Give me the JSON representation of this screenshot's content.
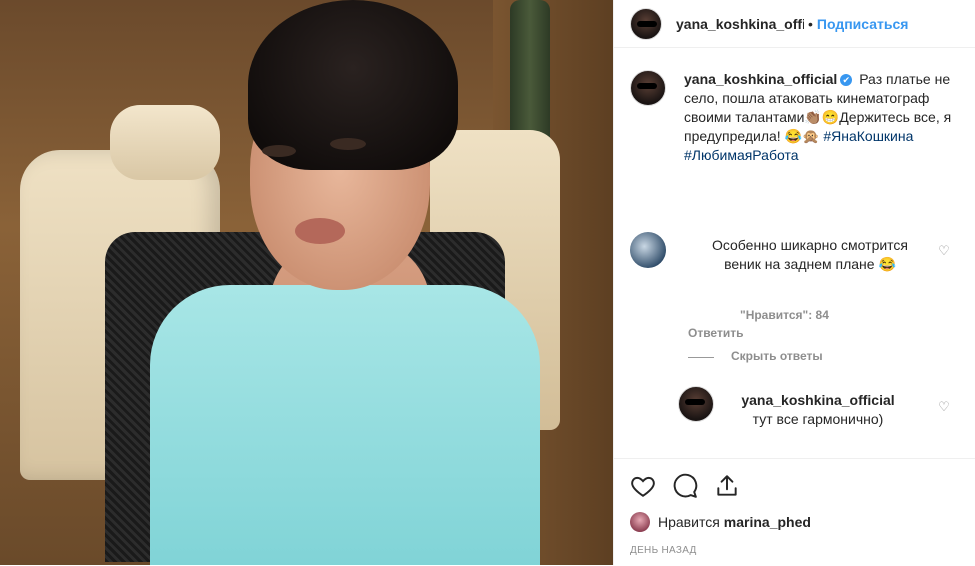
{
  "header": {
    "username": "yana_koshkina_official",
    "separator": "•",
    "follow_label": "Подписаться"
  },
  "caption": {
    "username": "yana_koshkina_official",
    "verified_glyph": "✔",
    "text": "Раз платье не село, пошла атаковать кинематограф своими талантами👏🏽😁Держитесь все, я предупредила! 😂🙊",
    "hashtags": [
      "#ЯнаКошкина",
      "#ЛюбимаяРабота"
    ]
  },
  "comments": [
    {
      "text": "Особенно шикарно смотрится веник на заднем плане 😂",
      "likes_label": "\"Нравится\": 84",
      "reply_label": "Ответить",
      "hide_replies_label": "Скрыть ответы"
    }
  ],
  "reply": {
    "username": "yana_koshkina_official",
    "text": "тут все гармонично)"
  },
  "actions": {
    "liked_by_prefix": "Нравится",
    "liked_by_user": "marina_phed",
    "date": "ДЕНЬ НАЗАД"
  },
  "icons": {
    "like": "heart-icon",
    "comment": "comment-icon",
    "share": "share-icon",
    "verified": "verified-badge-icon"
  },
  "colors": {
    "accent": "#3897f0",
    "text": "#262626",
    "muted": "#8e8e8e",
    "hashtag": "#003569"
  }
}
